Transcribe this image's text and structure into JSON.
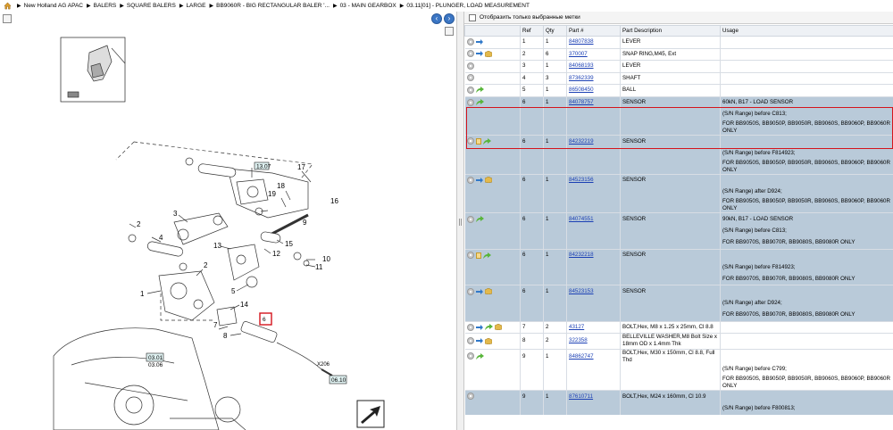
{
  "breadcrumb": {
    "home_icon": "home-icon",
    "items": [
      "New Holland AG APAC",
      "BALERS",
      "SQUARE BALERS",
      "LARGE",
      "BB9060R - BIG RECTANGULAR BALER '...",
      "03 - MAIN GEARBOX",
      "03.11[01] - PLUNGER, LOAD MEASUREMENT"
    ]
  },
  "toolbar": {
    "prev_icon": "arrow-left-icon",
    "next_icon": "arrow-right-icon",
    "prev": "‹",
    "next": "›"
  },
  "drawing": {
    "callouts": [
      "17",
      "16",
      "19",
      "18",
      "9",
      "2",
      "3",
      "4",
      "13",
      "12",
      "15",
      "10",
      "11",
      "2",
      "1",
      "5",
      "14",
      "7",
      "8",
      "6",
      "X206"
    ],
    "ref_boxes": [
      "03.01",
      "03.06",
      "06.10",
      "13.07"
    ],
    "highlight_callout": "6"
  },
  "filter": {
    "label": "Отобразить только выбранные метки"
  },
  "table": {
    "headers": [
      "",
      "Ref",
      "Qty",
      "Part #",
      "Part Description",
      "Usage"
    ],
    "rows": [
      {
        "style": "white",
        "icons": [
          "circle",
          "arrow-blue"
        ],
        "ref": "1",
        "qty": "1",
        "part": "84807838",
        "desc": "LEVER",
        "usage": ""
      },
      {
        "style": "white",
        "icons": [
          "circle",
          "arrow-blue",
          "box"
        ],
        "ref": "2",
        "qty": "6",
        "part": "370007",
        "desc": "SNAP RING,M45, Ext",
        "usage": ""
      },
      {
        "style": "white",
        "icons": [
          "circle"
        ],
        "ref": "3",
        "qty": "1",
        "part": "84068193",
        "desc": "LEVER",
        "usage": ""
      },
      {
        "style": "white",
        "icons": [
          "circle"
        ],
        "ref": "4",
        "qty": "3",
        "part": "87362339",
        "desc": "SHAFT",
        "usage": ""
      },
      {
        "style": "white",
        "icons": [
          "circle",
          "arrow-green"
        ],
        "ref": "5",
        "qty": "1",
        "part": "86508450",
        "desc": "BALL",
        "usage": ""
      },
      {
        "style": "blue",
        "icons": [
          "circle",
          "arrow-green"
        ],
        "ref": "6",
        "qty": "1",
        "part": "84078757",
        "desc": "SENSOR",
        "usage": "60kN, B17 - LOAD SENSOR"
      },
      {
        "style": "blue",
        "icons": [],
        "ref": "",
        "qty": "",
        "part": "",
        "desc": "",
        "usage": "(S/N Range) before C813;"
      },
      {
        "style": "blue",
        "icons": [],
        "ref": "",
        "qty": "",
        "part": "",
        "desc": "",
        "usage": "FOR BB9050S, BB9050P, BB9050R, BB9060S, BB9060P, BB9060R ONLY"
      },
      {
        "style": "blue",
        "icons": [
          "circle",
          "note",
          "arrow-green"
        ],
        "ref": "6",
        "qty": "1",
        "part": "84232219",
        "desc": "SENSOR",
        "usage": ""
      },
      {
        "style": "blue",
        "icons": [],
        "ref": "",
        "qty": "",
        "part": "",
        "desc": "",
        "usage": "(S/N Range) before F814923;"
      },
      {
        "style": "blue",
        "icons": [],
        "ref": "",
        "qty": "",
        "part": "",
        "desc": "",
        "usage": "FOR BB9050S, BB9050P, BB9050R, BB9060S, BB9060P, BB9060R ONLY"
      },
      {
        "style": "blue",
        "icons": [
          "circle",
          "arrow-blue",
          "box"
        ],
        "ref": "6",
        "qty": "1",
        "part": "84523156",
        "desc": "SENSOR",
        "usage": ""
      },
      {
        "style": "blue",
        "icons": [],
        "ref": "",
        "qty": "",
        "part": "",
        "desc": "",
        "usage": "(S/N Range) after D924;"
      },
      {
        "style": "blue",
        "icons": [],
        "ref": "",
        "qty": "",
        "part": "",
        "desc": "",
        "usage": "FOR BB9050S, BB9050P, BB9050R, BB9060S, BB9060P, BB9060R ONLY"
      },
      {
        "style": "blue",
        "icons": [
          "circle",
          "arrow-green"
        ],
        "ref": "6",
        "qty": "1",
        "part": "84074551",
        "desc": "SENSOR",
        "usage": "90kN, B17 - LOAD SENSOR"
      },
      {
        "style": "blue",
        "icons": [],
        "ref": "",
        "qty": "",
        "part": "",
        "desc": "",
        "usage": "(S/N Range) before C813;"
      },
      {
        "style": "blue",
        "icons": [],
        "ref": "",
        "qty": "",
        "part": "",
        "desc": "",
        "usage": "FOR BB9070S, BB9070R, BB9080S, BB9080R ONLY"
      },
      {
        "style": "blue",
        "icons": [
          "circle",
          "note",
          "arrow-green"
        ],
        "ref": "6",
        "qty": "1",
        "part": "84232218",
        "desc": "SENSOR",
        "usage": ""
      },
      {
        "style": "blue",
        "icons": [],
        "ref": "",
        "qty": "",
        "part": "",
        "desc": "",
        "usage": "(S/N Range) before F814923;"
      },
      {
        "style": "blue",
        "icons": [],
        "ref": "",
        "qty": "",
        "part": "",
        "desc": "",
        "usage": "FOR BB9070S, BB9070R, BB9080S, BB9080R ONLY"
      },
      {
        "style": "blue",
        "icons": [
          "circle",
          "arrow-blue",
          "box"
        ],
        "ref": "6",
        "qty": "1",
        "part": "84523153",
        "desc": "SENSOR",
        "usage": ""
      },
      {
        "style": "blue",
        "icons": [],
        "ref": "",
        "qty": "",
        "part": "",
        "desc": "",
        "usage": "(S/N Range) after D924;"
      },
      {
        "style": "blue",
        "icons": [],
        "ref": "",
        "qty": "",
        "part": "",
        "desc": "",
        "usage": "FOR BB9070S, BB9070R, BB9080S, BB9080R ONLY"
      },
      {
        "style": "white",
        "icons": [
          "circle",
          "arrow-blue",
          "arrow-green",
          "box"
        ],
        "ref": "7",
        "qty": "2",
        "part": "43127",
        "desc": "BOLT,Hex, M8 x 1.25 x 25mm, Cl 8.8",
        "usage": ""
      },
      {
        "style": "white",
        "icons": [
          "circle",
          "arrow-blue",
          "box"
        ],
        "ref": "8",
        "qty": "2",
        "part": "322358",
        "desc": "BELLEVILLE WASHER,M8 Bolt Size x 18mm OD x 1.4mm Thk",
        "usage": ""
      },
      {
        "style": "white",
        "icons": [
          "circle",
          "arrow-green"
        ],
        "ref": "9",
        "qty": "1",
        "part": "84862747",
        "desc": "BOLT,Hex, M30 x 150mm, Cl 8.8, Full Thd",
        "usage": ""
      },
      {
        "style": "white",
        "icons": [],
        "ref": "",
        "qty": "",
        "part": "",
        "desc": "",
        "usage": "(S/N Range) before C799;"
      },
      {
        "style": "white",
        "icons": [],
        "ref": "",
        "qty": "",
        "part": "",
        "desc": "",
        "usage": "FOR BB9050S, BB9050P, BB9050R, BB9060S, BB9060P, BB9060R ONLY"
      },
      {
        "style": "blue",
        "icons": [
          "circle"
        ],
        "ref": "9",
        "qty": "1",
        "part": "87610711",
        "desc": "BOLT,Hex, M24 x 160mm, Cl 10.9",
        "usage": ""
      },
      {
        "style": "blue",
        "icons": [],
        "ref": "",
        "qty": "",
        "part": "",
        "desc": "",
        "usage": "(S/N Range) before F800813;"
      }
    ]
  },
  "colors": {
    "selected_row": "#b9cad9",
    "highlight_border": "#d4141c",
    "link": "#1a3fb4"
  }
}
